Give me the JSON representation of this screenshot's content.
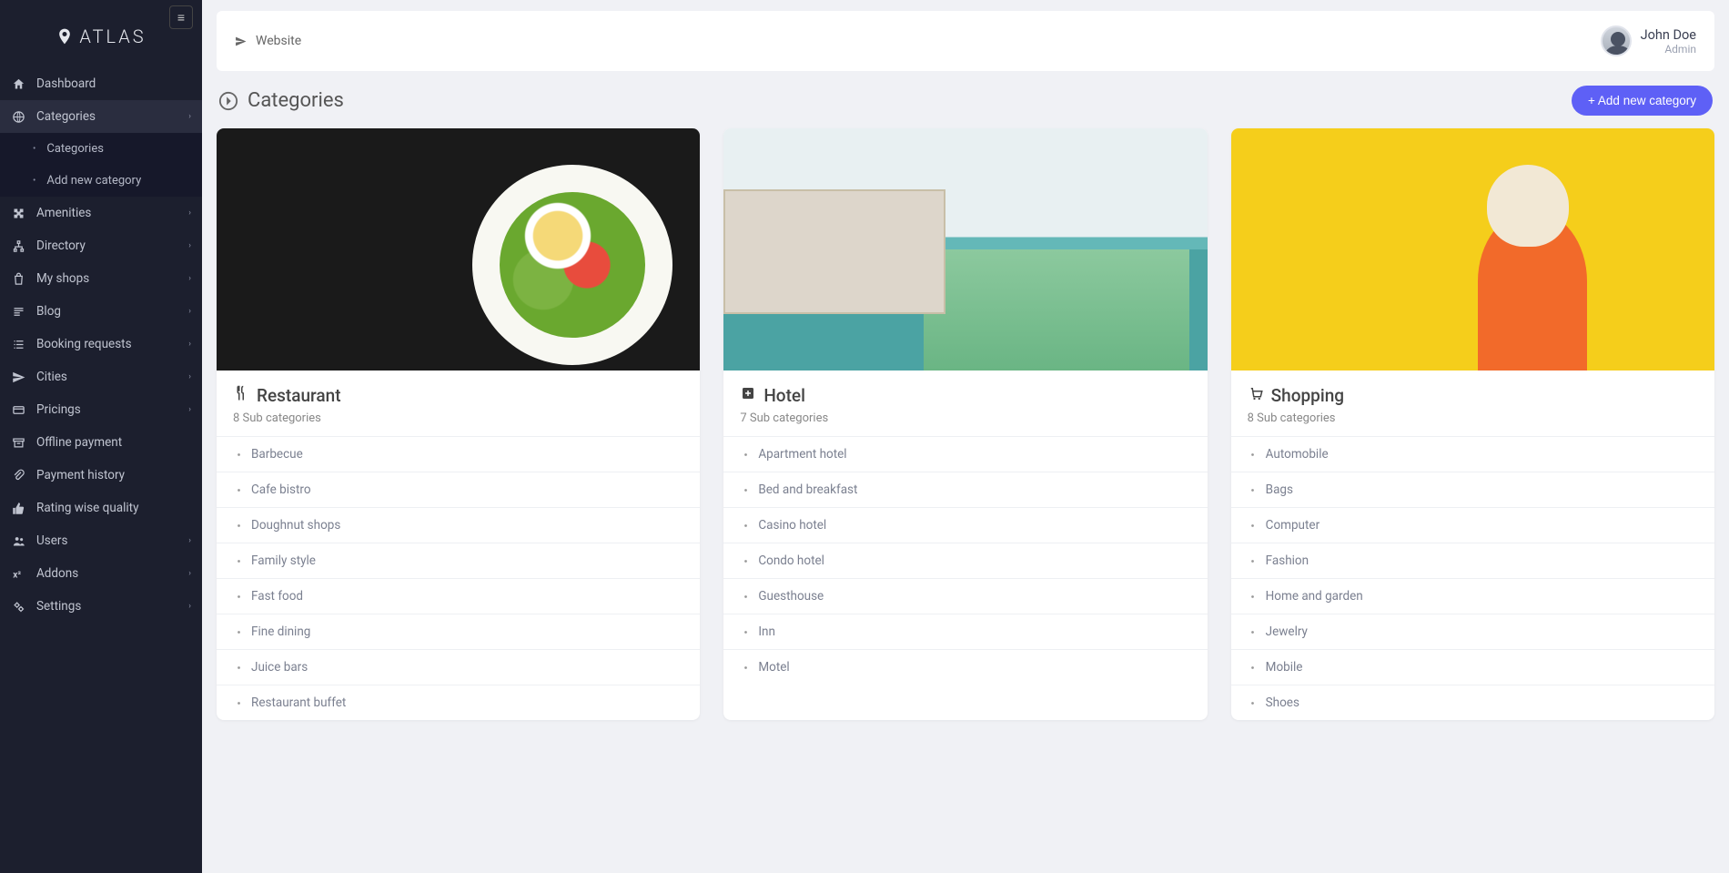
{
  "brand": "ATLAS",
  "topbar": {
    "website_label": "Website"
  },
  "user": {
    "name": "John Doe",
    "role": "Admin"
  },
  "page": {
    "title": "Categories",
    "add_btn": "+ Add new category"
  },
  "sidebar": {
    "items": [
      {
        "label": "Dashboard",
        "icon": "home-icon",
        "expandable": false
      },
      {
        "label": "Categories",
        "icon": "globe-icon",
        "expandable": true,
        "active": true,
        "children": [
          {
            "label": "Categories"
          },
          {
            "label": "Add new category"
          }
        ]
      },
      {
        "label": "Amenities",
        "icon": "puzzle-icon",
        "expandable": true
      },
      {
        "label": "Directory",
        "icon": "sitemap-icon",
        "expandable": true
      },
      {
        "label": "My shops",
        "icon": "bag-icon",
        "expandable": true
      },
      {
        "label": "Blog",
        "icon": "lines-icon",
        "expandable": true
      },
      {
        "label": "Booking requests",
        "icon": "list-icon",
        "expandable": true
      },
      {
        "label": "Cities",
        "icon": "send-icon",
        "expandable": true
      },
      {
        "label": "Pricings",
        "icon": "card-icon",
        "expandable": true
      },
      {
        "label": "Offline payment",
        "icon": "archive-icon",
        "expandable": false
      },
      {
        "label": "Payment history",
        "icon": "clip-icon",
        "expandable": false
      },
      {
        "label": "Rating wise quality",
        "icon": "thumb-icon",
        "expandable": false
      },
      {
        "label": "Users",
        "icon": "users-icon",
        "expandable": true
      },
      {
        "label": "Addons",
        "icon": "formula-icon",
        "expandable": true
      },
      {
        "label": "Settings",
        "icon": "gears-icon",
        "expandable": true
      }
    ]
  },
  "cards": [
    {
      "title": "Restaurant",
      "icon": "utensils-icon",
      "sub": "8 Sub categories",
      "img": "restaurant",
      "items": [
        {
          "label": "Barbecue",
          "icon": "glass-icon"
        },
        {
          "label": "Cafe bistro",
          "icon": "coffee-icon"
        },
        {
          "label": "Doughnut shops",
          "icon": "donut-icon"
        },
        {
          "label": "Family style",
          "icon": "child-icon"
        },
        {
          "label": "Fast food",
          "icon": "burger-icon"
        },
        {
          "label": "Fine dining",
          "icon": "wine-icon"
        },
        {
          "label": "Juice bars",
          "icon": "juice-icon"
        },
        {
          "label": "Restaurant buffet",
          "icon": "buffet-icon"
        }
      ]
    },
    {
      "title": "Hotel",
      "icon": "hospital-icon",
      "sub": "7 Sub categories",
      "img": "hotel",
      "items": [
        {
          "label": "Apartment hotel",
          "icon": "building-icon"
        },
        {
          "label": "Bed and breakfast",
          "icon": "bed-icon"
        },
        {
          "label": "Casino hotel",
          "icon": "casino-icon"
        },
        {
          "label": "Condo hotel",
          "icon": "condo-icon"
        },
        {
          "label": "Guesthouse",
          "icon": "house-icon"
        },
        {
          "label": "Inn",
          "icon": "inn-icon"
        },
        {
          "label": "Motel",
          "icon": "motel-icon"
        }
      ]
    },
    {
      "title": "Shopping",
      "icon": "cart-icon",
      "sub": "8 Sub categories",
      "img": "shopping",
      "items": [
        {
          "label": "Automobile",
          "icon": "car-icon"
        },
        {
          "label": "Bags",
          "icon": "bag2-icon"
        },
        {
          "label": "Computer",
          "icon": "laptop-icon"
        },
        {
          "label": "Fashion",
          "icon": "fashion-icon"
        },
        {
          "label": "Home and garden",
          "icon": "home2-icon"
        },
        {
          "label": "Jewelry",
          "icon": "ring-icon"
        },
        {
          "label": "Mobile",
          "icon": "mobile-icon"
        },
        {
          "label": "Shoes",
          "icon": "shoe-icon"
        }
      ]
    }
  ]
}
